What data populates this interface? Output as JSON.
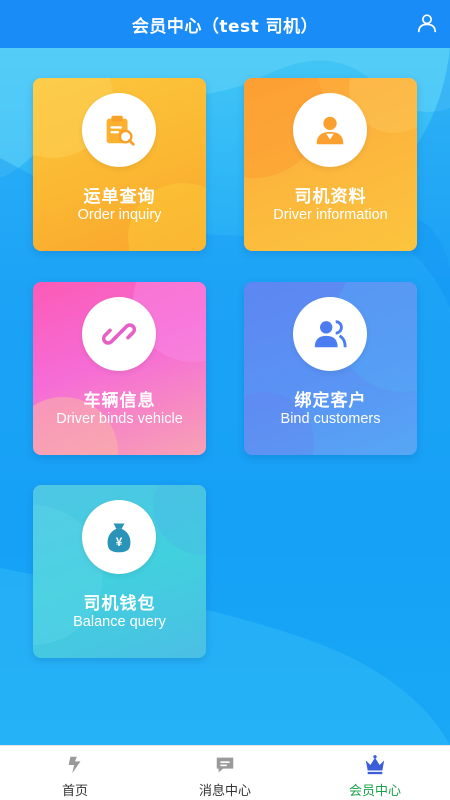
{
  "header": {
    "title": "会员中心（test 司机）",
    "user_icon": "user-icon"
  },
  "colors": {
    "header_bg": "#1a8cf8",
    "active_tab": "#1aa14b",
    "order_card": "#fbb732",
    "driver_card": "#fcb83d",
    "vehicle_card": "#f66cd6",
    "bind_card": "#5a93f4",
    "wallet_card": "#41d0de"
  },
  "cards": [
    {
      "cn": "运单查询",
      "en": "Order inquiry",
      "icon": "order-search-icon"
    },
    {
      "cn": "司机资料",
      "en": "Driver information",
      "icon": "driver-profile-icon"
    },
    {
      "cn": "车辆信息",
      "en": "Driver binds vehicle",
      "icon": "link-icon"
    },
    {
      "cn": "绑定客户",
      "en": "Bind customers",
      "icon": "customers-icon"
    },
    {
      "cn": "司机钱包",
      "en": "Balance query",
      "icon": "money-bag-icon"
    }
  ],
  "tabs": [
    {
      "label": "首页",
      "icon": "home-icon",
      "active": false
    },
    {
      "label": "消息中心",
      "icon": "message-icon",
      "active": false
    },
    {
      "label": "会员中心",
      "icon": "crown-icon",
      "active": true
    }
  ]
}
